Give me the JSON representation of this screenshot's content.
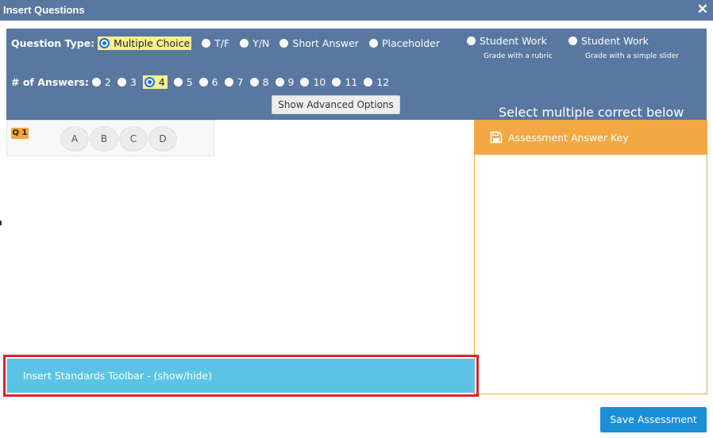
{
  "window": {
    "title": "Insert Questions",
    "close_glyph": "✕"
  },
  "question_type": {
    "label": "Question Type:",
    "options": [
      {
        "label": "Multiple Choice",
        "selected": true
      },
      {
        "label": "T/F",
        "selected": false
      },
      {
        "label": "Y/N",
        "selected": false
      },
      {
        "label": "Short Answer",
        "selected": false
      },
      {
        "label": "Placeholder",
        "selected": false
      },
      {
        "label": "Student Work",
        "sublabel": "Grade with a rubric",
        "selected": false
      },
      {
        "label": "Student Work",
        "sublabel": "Grade with a simple slider",
        "selected": false
      }
    ]
  },
  "answers_count": {
    "label": "# of Answers:",
    "options": [
      "2",
      "3",
      "4",
      "5",
      "6",
      "7",
      "8",
      "9",
      "10",
      "11",
      "12"
    ],
    "selected": "4"
  },
  "advanced_button": "Show Advanced Options",
  "select_multiple_note": "Select multiple correct below",
  "question": {
    "number": "Q 1",
    "answers": [
      "A",
      "B",
      "C",
      "D"
    ]
  },
  "answer_key": {
    "title": "Assessment Answer Key",
    "icon": "save-icon"
  },
  "standards_toolbar": "Insert Standards Toolbar - (show/hide)",
  "save_button": "Save Assessment",
  "colors": {
    "header_blue": "#5878a1",
    "answer_key_orange": "#f3a843",
    "standards_bar": "#5bc4e6",
    "save_button": "#1a8fd8",
    "highlight_outline": "#e0222b",
    "selection_yellow": "#f6f08d"
  }
}
